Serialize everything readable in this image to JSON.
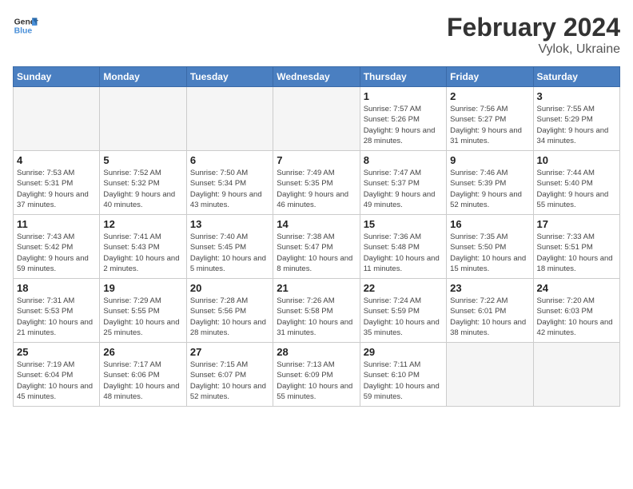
{
  "header": {
    "logo": {
      "line1": "General",
      "line2": "Blue"
    },
    "title": "February 2024",
    "location": "Vylok, Ukraine"
  },
  "days_of_week": [
    "Sunday",
    "Monday",
    "Tuesday",
    "Wednesday",
    "Thursday",
    "Friday",
    "Saturday"
  ],
  "weeks": [
    [
      {
        "day": "",
        "empty": true
      },
      {
        "day": "",
        "empty": true
      },
      {
        "day": "",
        "empty": true
      },
      {
        "day": "",
        "empty": true
      },
      {
        "day": "1",
        "sunrise": "7:57 AM",
        "sunset": "5:26 PM",
        "daylight": "9 hours and 28 minutes."
      },
      {
        "day": "2",
        "sunrise": "7:56 AM",
        "sunset": "5:27 PM",
        "daylight": "9 hours and 31 minutes."
      },
      {
        "day": "3",
        "sunrise": "7:55 AM",
        "sunset": "5:29 PM",
        "daylight": "9 hours and 34 minutes."
      }
    ],
    [
      {
        "day": "4",
        "sunrise": "7:53 AM",
        "sunset": "5:31 PM",
        "daylight": "9 hours and 37 minutes."
      },
      {
        "day": "5",
        "sunrise": "7:52 AM",
        "sunset": "5:32 PM",
        "daylight": "9 hours and 40 minutes."
      },
      {
        "day": "6",
        "sunrise": "7:50 AM",
        "sunset": "5:34 PM",
        "daylight": "9 hours and 43 minutes."
      },
      {
        "day": "7",
        "sunrise": "7:49 AM",
        "sunset": "5:35 PM",
        "daylight": "9 hours and 46 minutes."
      },
      {
        "day": "8",
        "sunrise": "7:47 AM",
        "sunset": "5:37 PM",
        "daylight": "9 hours and 49 minutes."
      },
      {
        "day": "9",
        "sunrise": "7:46 AM",
        "sunset": "5:39 PM",
        "daylight": "9 hours and 52 minutes."
      },
      {
        "day": "10",
        "sunrise": "7:44 AM",
        "sunset": "5:40 PM",
        "daylight": "9 hours and 55 minutes."
      }
    ],
    [
      {
        "day": "11",
        "sunrise": "7:43 AM",
        "sunset": "5:42 PM",
        "daylight": "9 hours and 59 minutes."
      },
      {
        "day": "12",
        "sunrise": "7:41 AM",
        "sunset": "5:43 PM",
        "daylight": "10 hours and 2 minutes."
      },
      {
        "day": "13",
        "sunrise": "7:40 AM",
        "sunset": "5:45 PM",
        "daylight": "10 hours and 5 minutes."
      },
      {
        "day": "14",
        "sunrise": "7:38 AM",
        "sunset": "5:47 PM",
        "daylight": "10 hours and 8 minutes."
      },
      {
        "day": "15",
        "sunrise": "7:36 AM",
        "sunset": "5:48 PM",
        "daylight": "10 hours and 11 minutes."
      },
      {
        "day": "16",
        "sunrise": "7:35 AM",
        "sunset": "5:50 PM",
        "daylight": "10 hours and 15 minutes."
      },
      {
        "day": "17",
        "sunrise": "7:33 AM",
        "sunset": "5:51 PM",
        "daylight": "10 hours and 18 minutes."
      }
    ],
    [
      {
        "day": "18",
        "sunrise": "7:31 AM",
        "sunset": "5:53 PM",
        "daylight": "10 hours and 21 minutes."
      },
      {
        "day": "19",
        "sunrise": "7:29 AM",
        "sunset": "5:55 PM",
        "daylight": "10 hours and 25 minutes."
      },
      {
        "day": "20",
        "sunrise": "7:28 AM",
        "sunset": "5:56 PM",
        "daylight": "10 hours and 28 minutes."
      },
      {
        "day": "21",
        "sunrise": "7:26 AM",
        "sunset": "5:58 PM",
        "daylight": "10 hours and 31 minutes."
      },
      {
        "day": "22",
        "sunrise": "7:24 AM",
        "sunset": "5:59 PM",
        "daylight": "10 hours and 35 minutes."
      },
      {
        "day": "23",
        "sunrise": "7:22 AM",
        "sunset": "6:01 PM",
        "daylight": "10 hours and 38 minutes."
      },
      {
        "day": "24",
        "sunrise": "7:20 AM",
        "sunset": "6:03 PM",
        "daylight": "10 hours and 42 minutes."
      }
    ],
    [
      {
        "day": "25",
        "sunrise": "7:19 AM",
        "sunset": "6:04 PM",
        "daylight": "10 hours and 45 minutes."
      },
      {
        "day": "26",
        "sunrise": "7:17 AM",
        "sunset": "6:06 PM",
        "daylight": "10 hours and 48 minutes."
      },
      {
        "day": "27",
        "sunrise": "7:15 AM",
        "sunset": "6:07 PM",
        "daylight": "10 hours and 52 minutes."
      },
      {
        "day": "28",
        "sunrise": "7:13 AM",
        "sunset": "6:09 PM",
        "daylight": "10 hours and 55 minutes."
      },
      {
        "day": "29",
        "sunrise": "7:11 AM",
        "sunset": "6:10 PM",
        "daylight": "10 hours and 59 minutes."
      },
      {
        "day": "",
        "empty": true
      },
      {
        "day": "",
        "empty": true
      }
    ]
  ]
}
